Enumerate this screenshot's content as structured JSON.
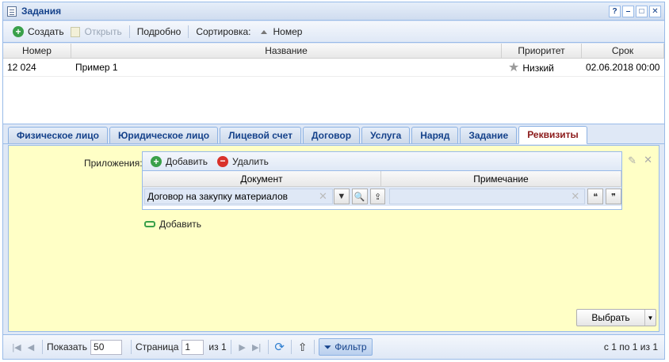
{
  "window": {
    "title": "Задания",
    "tools": [
      "?",
      "–",
      "□",
      "✕"
    ]
  },
  "toolbar": {
    "create": "Создать",
    "open": "Открыть",
    "details": "Подробно",
    "sort_label": "Сортировка:",
    "sort_field": "Номер"
  },
  "grid": {
    "columns": [
      "Номер",
      "Название",
      "Приоритет",
      "Срок"
    ],
    "rows": [
      {
        "number": "12 024",
        "name": "Пример 1",
        "priority": "Низкий",
        "due": "02.06.2018 00:00"
      }
    ]
  },
  "tabs": [
    "Физическое лицо",
    "Юридическое лицо",
    "Лицевой счет",
    "Договор",
    "Услуга",
    "Наряд",
    "Задание",
    "Реквизиты"
  ],
  "active_tab": "Реквизиты",
  "panel": {
    "attachments_label": "Приложения:",
    "add": "Добавить",
    "delete": "Удалить",
    "columns": [
      "Документ",
      "Примечание"
    ],
    "document_value": "Договор на закупку материалов",
    "add_link": "Добавить",
    "select_button": "Выбрать"
  },
  "pager": {
    "show_label": "Показать",
    "page_size": "50",
    "page_label": "Страница",
    "page": "1",
    "of": "из 1",
    "filter": "Фильтр",
    "info": "с 1 по 1 из 1"
  }
}
